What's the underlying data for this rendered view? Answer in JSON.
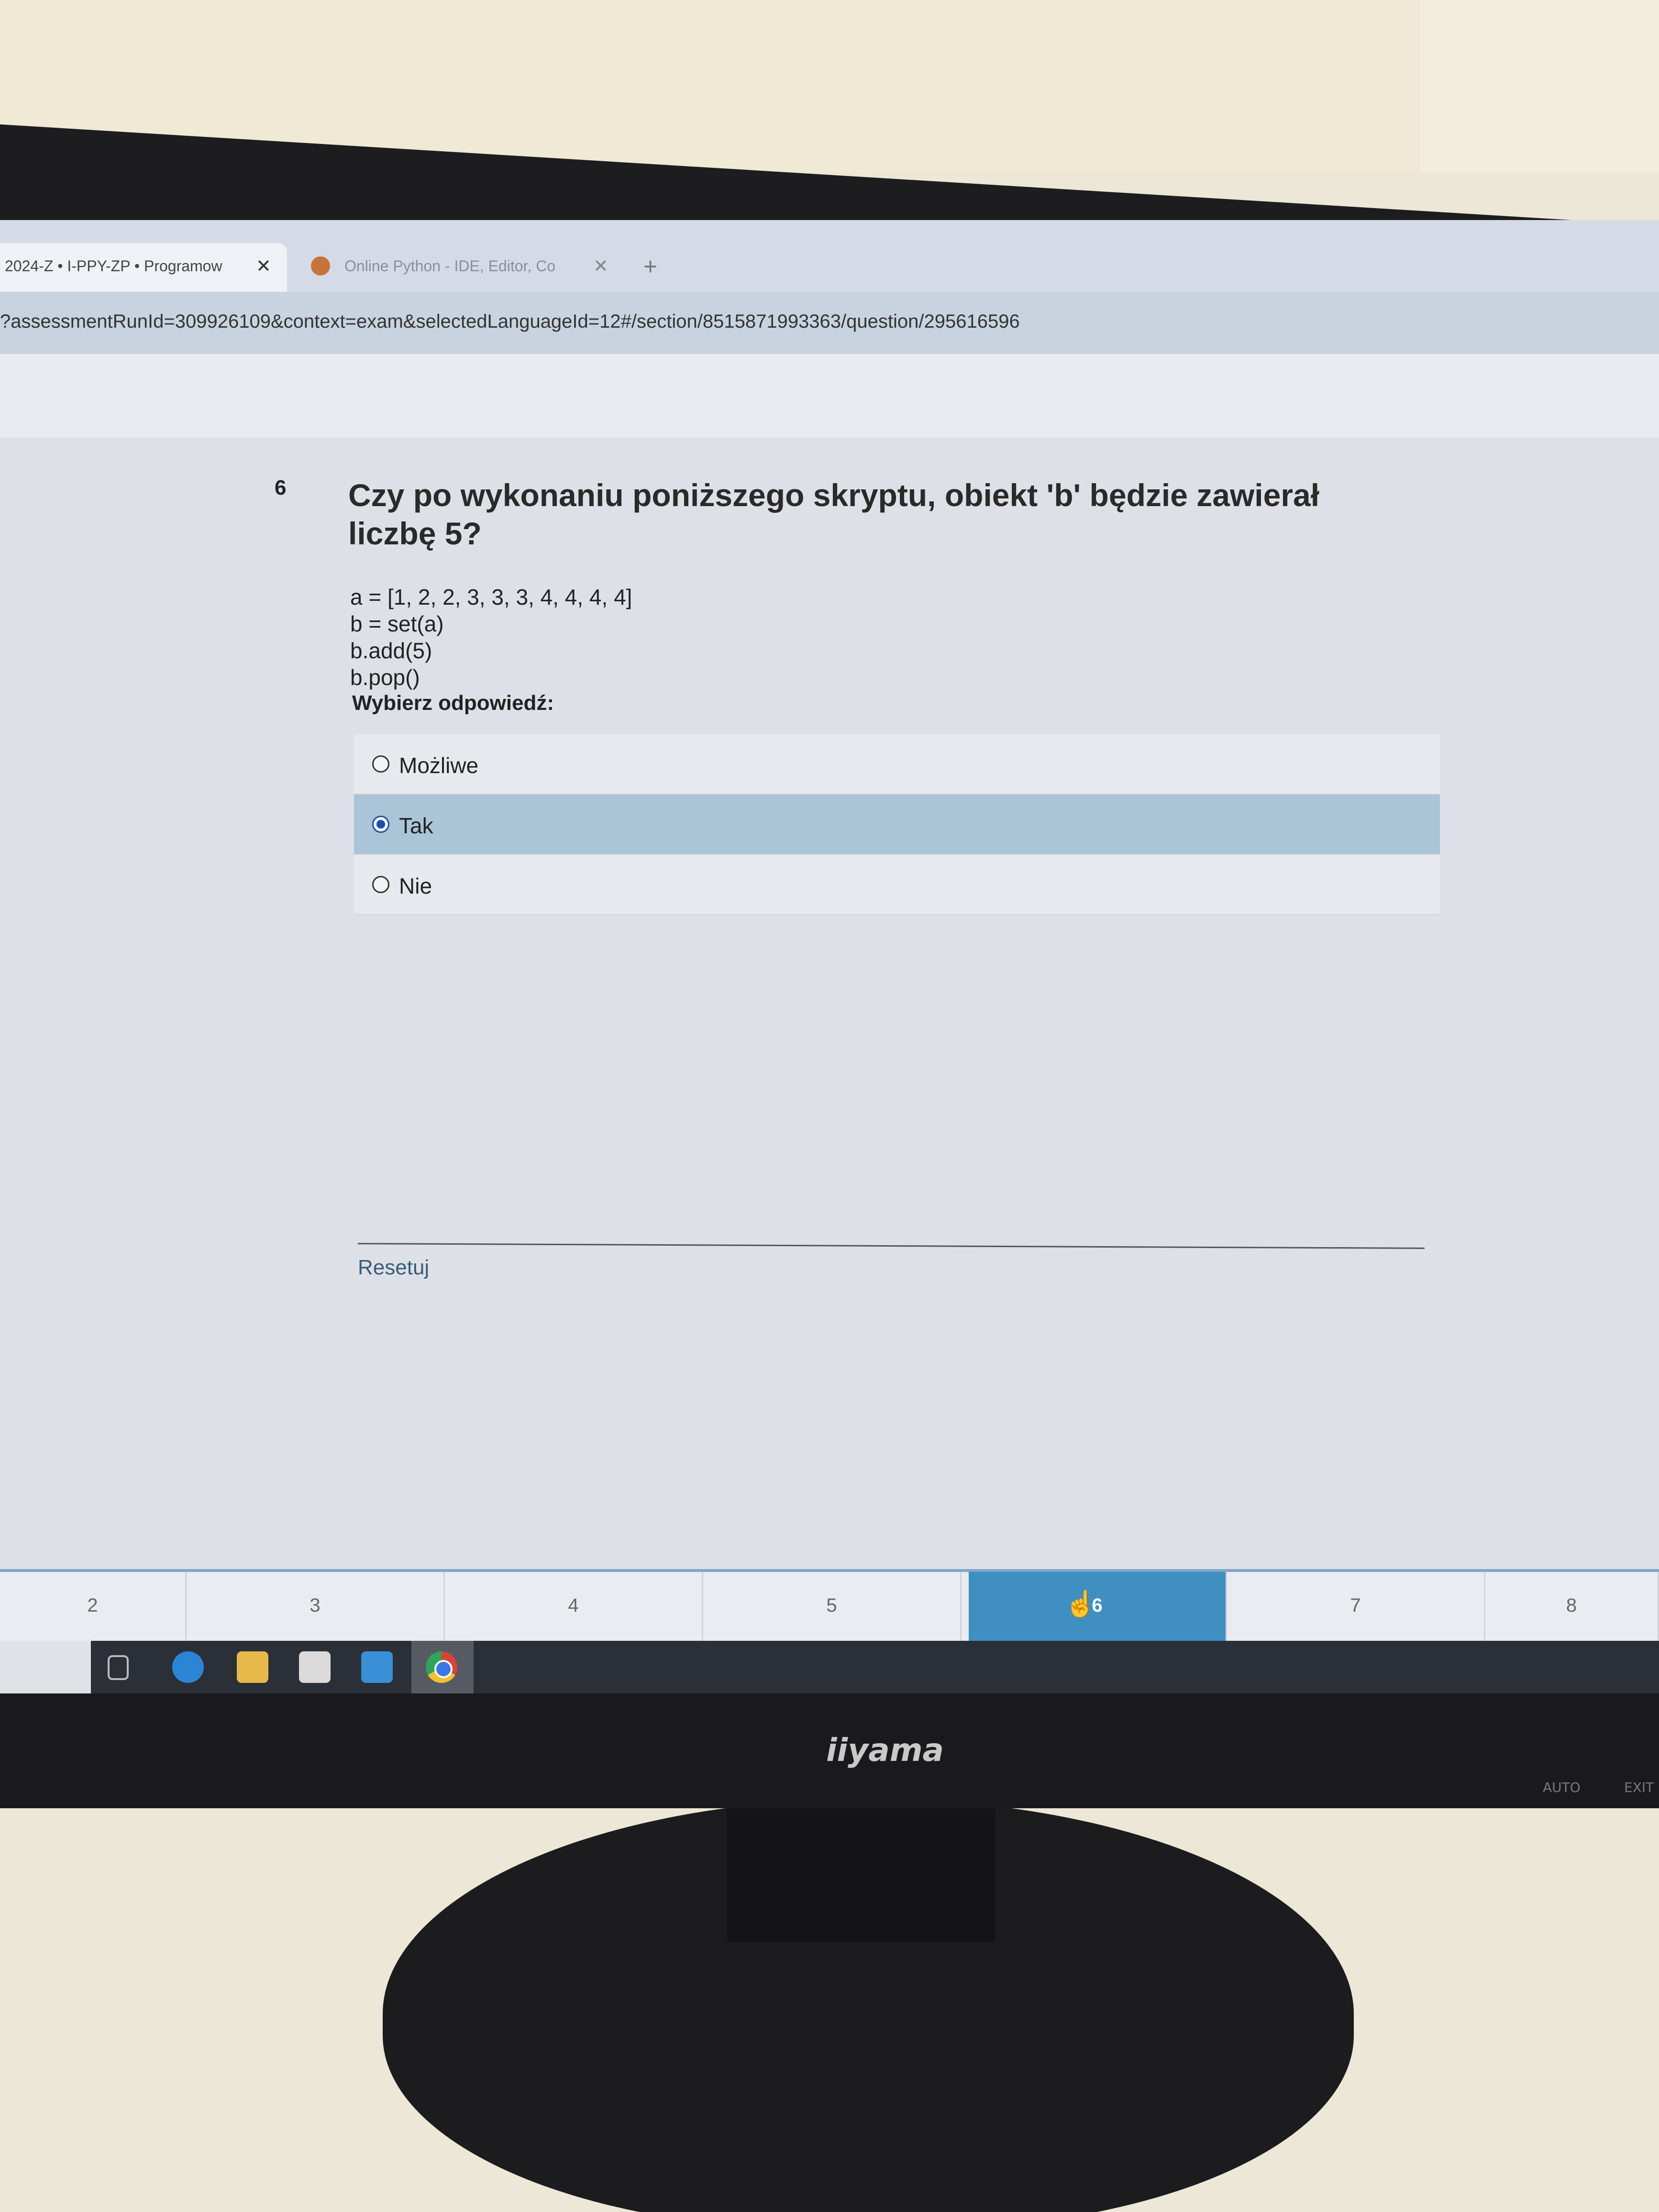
{
  "browser": {
    "tabs": [
      {
        "title": "2024-Z • I-PPY-ZP • Programow",
        "active": true
      },
      {
        "title": "Online Python - IDE, Editor, Co",
        "active": false
      }
    ],
    "url": "?assessmentRunId=309926109&context=exam&selectedLanguageId=12#/section/8515871993363/question/295616596"
  },
  "question": {
    "number": "6",
    "title": "Czy po wykonaniu poniższego skryptu, obiekt 'b' będzie zawierał liczbę 5?",
    "code_lines": [
      "a = [1, 2, 2, 3, 3, 3, 4, 4, 4, 4]",
      "b = set(a)",
      "b.add(5)",
      "b.pop()"
    ],
    "choose_label": "Wybierz odpowiedź:",
    "options": [
      {
        "label": "Możliwe",
        "selected": false
      },
      {
        "label": "Tak",
        "selected": true
      },
      {
        "label": "Nie",
        "selected": false
      }
    ],
    "reset_label": "Resetuj"
  },
  "pagination": {
    "pages": [
      "2",
      "3",
      "4",
      "5",
      "6",
      "7",
      "8"
    ],
    "current": "6"
  },
  "monitor": {
    "brand": "iiyama",
    "button_auto": "AUTO",
    "button_exit": "EXIT"
  },
  "colors": {
    "selected_option": "#aac4d8",
    "current_page": "#3f8fc2"
  },
  "taskbar_icons": [
    "task-view-icon",
    "edge-icon",
    "file-explorer-icon",
    "store-icon",
    "mail-icon",
    "chrome-icon"
  ]
}
